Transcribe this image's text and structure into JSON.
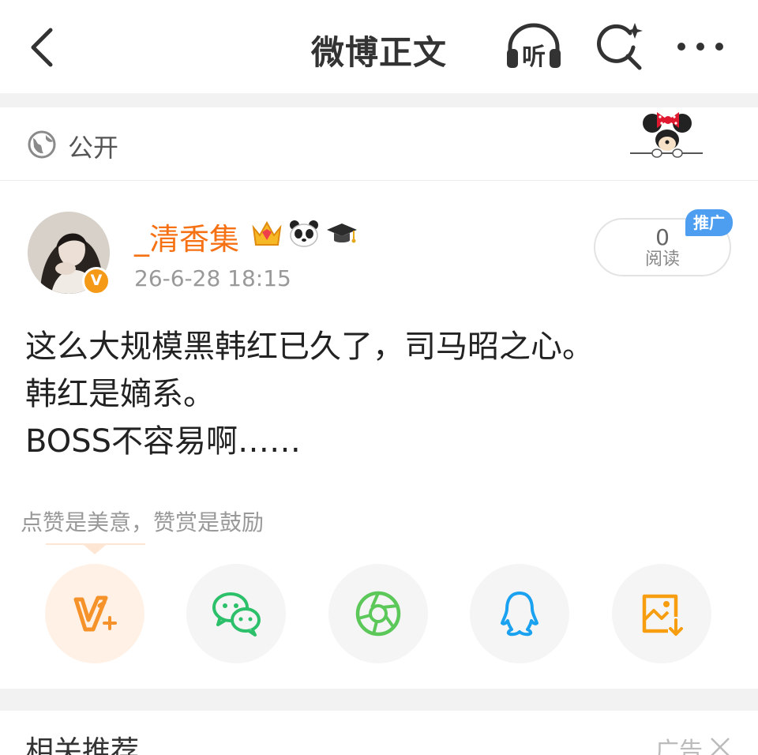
{
  "header": {
    "title": "微博正文",
    "listen_label": "听"
  },
  "visibility": {
    "label": "公开"
  },
  "author": {
    "name": "_清香集",
    "verified_mark": "V",
    "time": "26-6-28 18:15",
    "badges": [
      "crown-icon",
      "panda-icon",
      "graduation-cap-icon"
    ]
  },
  "stats": {
    "read_count": "0",
    "read_label": "阅读",
    "promo_tag": "推广"
  },
  "post": {
    "lines": [
      "这么大规模黑韩红已久了，司马昭之心。",
      "韩红是嫡系。",
      "BOSS不容易啊……"
    ]
  },
  "reward": {
    "hint": "点赞是美意，赞赏是鼓励",
    "actions": [
      "reward-icon",
      "wechat-icon",
      "moments-icon",
      "qq-icon",
      "save-image-icon"
    ]
  },
  "recommendations": {
    "title": "相关推荐",
    "ad_label": "广告"
  },
  "colors": {
    "accent_orange": "#f57113",
    "promo_blue": "#4d9ef0",
    "wechat_green": "#2dc06a",
    "qq_blue": "#1aa1f0",
    "save_orange": "#f79d10"
  }
}
